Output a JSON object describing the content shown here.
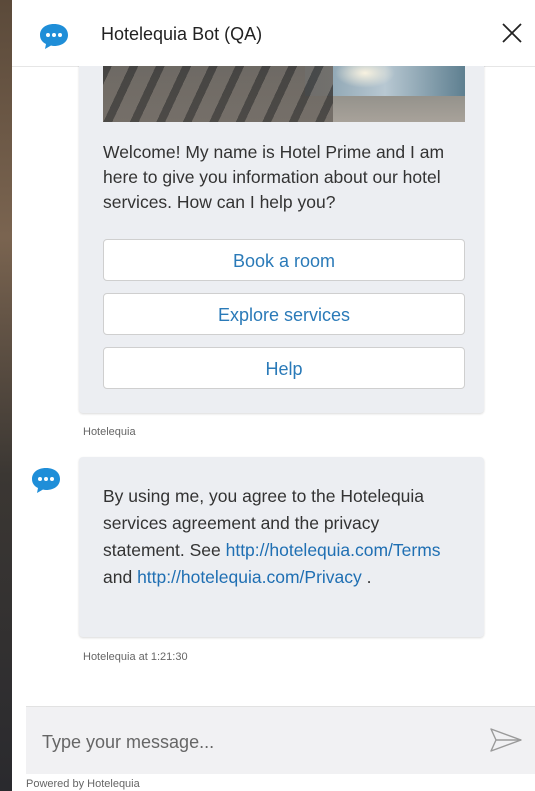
{
  "header": {
    "title": "Hotelequia Bot (QA)",
    "icon": "chat-bubble-icon",
    "close_icon": "close-icon"
  },
  "welcome_card": {
    "text": "Welcome! My name is Hotel Prime and I am here to give you information about our hotel services. How can I help you?",
    "buttons": [
      {
        "label": "Book a room"
      },
      {
        "label": "Explore services"
      },
      {
        "label": "Help"
      }
    ],
    "sender": "Hotelequia"
  },
  "agreement_message": {
    "text_part1": "By using me, you agree to the Hotelequia services agreement and the privacy statement. See",
    "link_terms": "http://hotelequia.com/Terms",
    "text_and": "and",
    "link_privacy": "http://hotelequia.com/Privacy",
    "text_end": ".",
    "meta": "Hotelequia at 1:21:30"
  },
  "composer": {
    "placeholder": "Type your message...",
    "send_icon": "send-icon"
  },
  "footer": {
    "powered_by": "Powered by Hotelequia"
  },
  "colors": {
    "accent": "#1f8ed8",
    "link": "#1f6fb3",
    "bubble_bg": "#eceef2"
  }
}
